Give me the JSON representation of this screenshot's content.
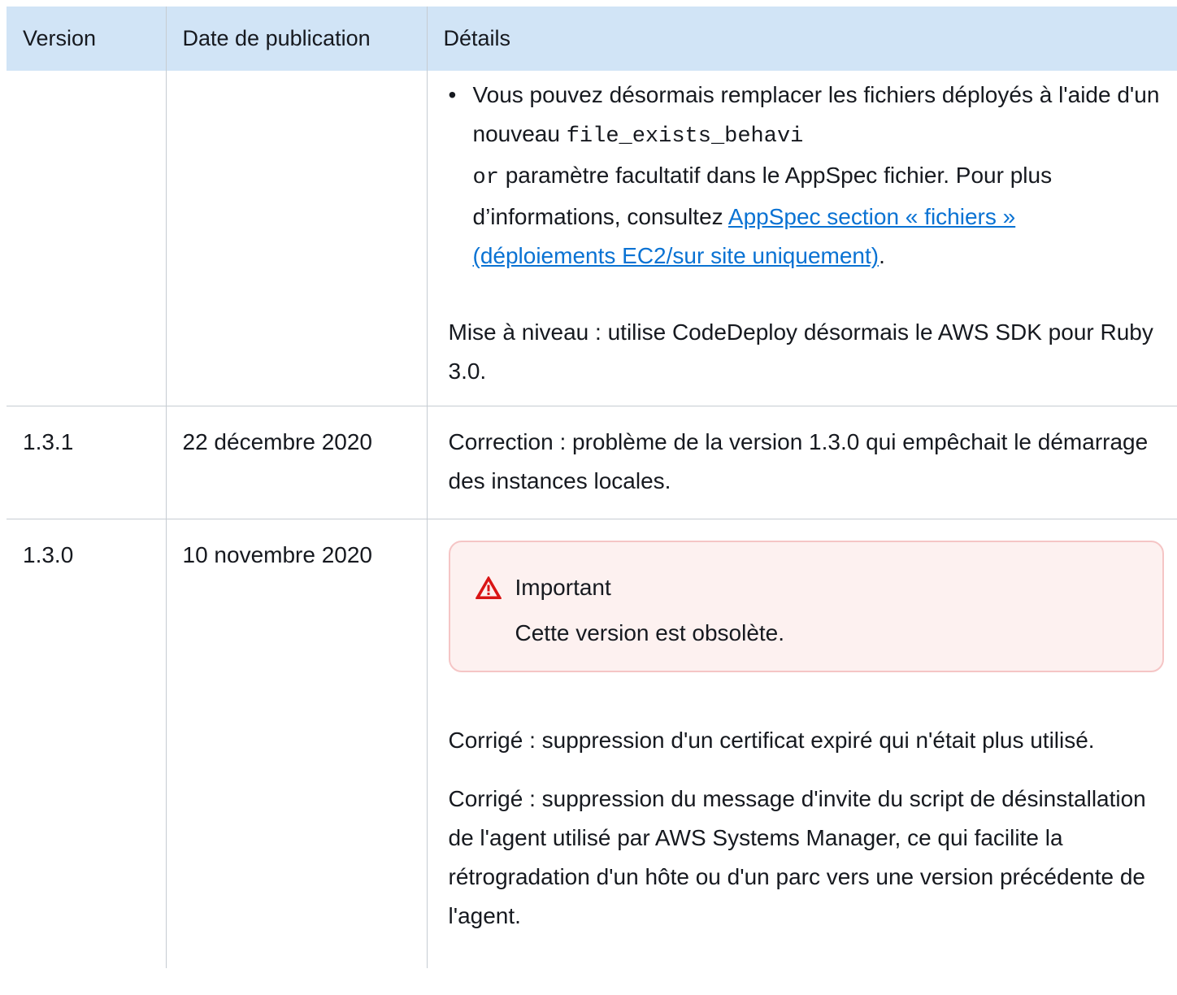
{
  "table": {
    "headers": [
      "Version",
      "Date de publication",
      "Détails"
    ],
    "row_continued": {
      "bullet": {
        "text_before": "Vous pouvez désormais remplacer les fichiers déployés à l'aide d'un nouveau",
        "code_line1": "file_exists_behavi",
        "code_line2": "or",
        "text_after": "paramètre facultatif dans le AppSpec fichier. Pour plus d’informations, consultez",
        "link_text": "AppSpec section « fichiers » (déploiements EC2/sur site uniquement)",
        "period": "."
      },
      "upgrade": "Mise à niveau : utilise CodeDeploy désormais le AWS SDK pour Ruby 3.0."
    },
    "row_131": {
      "version": "1.3.1",
      "date": "22 décembre 2020",
      "details": "Correction : problème de la version 1.3.0 qui empêchait le démarrage des instances locales."
    },
    "row_130": {
      "version": "1.3.0",
      "date": "10 novembre 2020",
      "callout": {
        "title": "Important",
        "body": "Cette version est obsolète."
      },
      "fix1": "Corrigé : suppression d'un certificat expiré qui n'était plus utilisé.",
      "fix2": "Corrigé : suppression du message d'invite du script de désinstallation de l'agent utilisé par AWS Systems Manager, ce qui facilite la rétrogradation d'un hôte ou d'un parc vers une version précédente de l'agent."
    }
  },
  "colors": {
    "header_bg": "#d1e4f6",
    "link": "#0972d3",
    "callout_bg": "#fdf1f0",
    "callout_border": "#f5c5c5",
    "warning_icon": "#d91515"
  },
  "icons": {
    "warning": "warning-triangle-icon"
  }
}
